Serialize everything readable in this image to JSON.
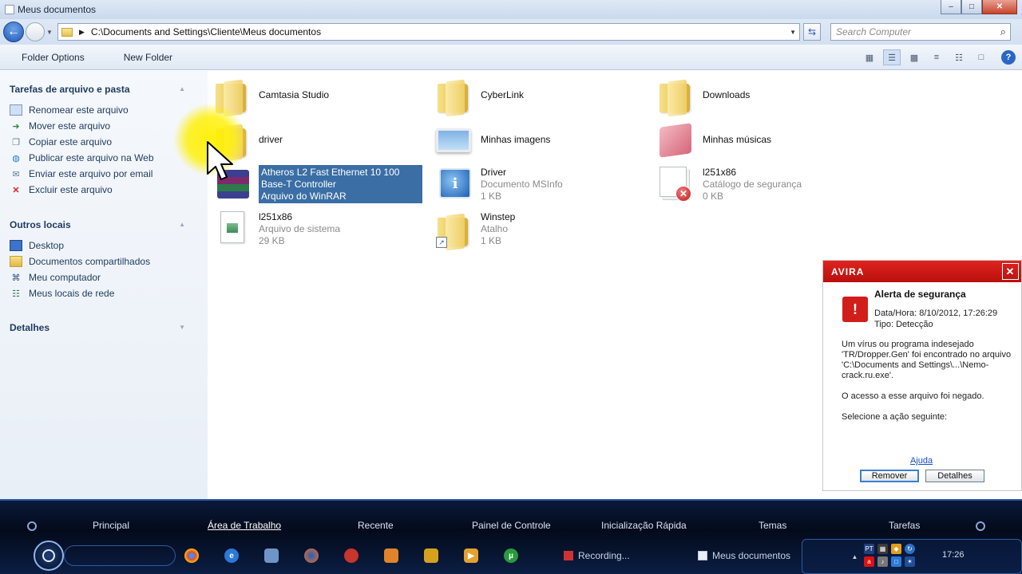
{
  "window": {
    "title": "Meus documentos"
  },
  "address": {
    "path": "C:\\Documents and Settings\\Cliente\\Meus documentos",
    "search_placeholder": "Search Computer"
  },
  "toolbar": {
    "folder_options": "Folder Options",
    "new_folder": "New Folder"
  },
  "sidebar": {
    "tasks_title": "Tarefas de arquivo e pasta",
    "tasks": [
      {
        "label": "Renomear este arquivo",
        "icon": "rename-icon"
      },
      {
        "label": "Mover este arquivo",
        "icon": "move-icon"
      },
      {
        "label": "Copiar este arquivo",
        "icon": "copy-icon"
      },
      {
        "label": "Publicar este arquivo na Web",
        "icon": "web-publish-icon"
      },
      {
        "label": "Enviar este arquivo por email",
        "icon": "email-icon"
      },
      {
        "label": "Excluir este arquivo",
        "icon": "delete-icon"
      }
    ],
    "places_title": "Outros locais",
    "places": [
      {
        "label": "Desktop",
        "icon": "desktop-icon"
      },
      {
        "label": "Documentos compartilhados",
        "icon": "folder-icon"
      },
      {
        "label": "Meu computador",
        "icon": "computer-icon"
      },
      {
        "label": "Meus locais de rede",
        "icon": "network-icon"
      }
    ],
    "details_title": "Detalhes"
  },
  "files": [
    {
      "name": "Camtasia Studio",
      "type": "",
      "size": "",
      "icon": "folder-icon"
    },
    {
      "name": "CyberLink",
      "type": "",
      "size": "",
      "icon": "folder-icon"
    },
    {
      "name": "Downloads",
      "type": "",
      "size": "",
      "icon": "folder-icon"
    },
    {
      "name": "driver",
      "type": "",
      "size": "",
      "icon": "folder-icon"
    },
    {
      "name": "Minhas imagens",
      "type": "",
      "size": "",
      "icon": "pictures-folder-icon"
    },
    {
      "name": "Minhas músicas",
      "type": "",
      "size": "",
      "icon": "music-folder-icon"
    },
    {
      "name": "Atheros L2 Fast Ethernet 10 100 Base-T Controller",
      "type": "Arquivo do WinRAR",
      "size": "",
      "icon": "winrar-icon",
      "selected": true
    },
    {
      "name": "Driver",
      "type": "Documento MSInfo",
      "size": "1 KB",
      "icon": "msinfo-icon"
    },
    {
      "name": "l251x86",
      "type": "Catálogo de segurança",
      "size": "0 KB",
      "icon": "security-catalog-icon"
    },
    {
      "name": "l251x86",
      "type": "Arquivo de sistema",
      "size": "29 KB",
      "icon": "system-file-icon"
    },
    {
      "name": "Winstep",
      "type": "Atalho",
      "size": "1 KB",
      "icon": "shortcut-folder-icon"
    }
  ],
  "avira": {
    "brand": "AVIRA",
    "title": "Alerta de segurança",
    "datetime": "Data/Hora: 8/10/2012, 17:26:29",
    "type": "Tipo: Detecção",
    "message": "Um vírus ou programa indesejado 'TR/Dropper.Gen' foi encontrado no arquivo 'C:\\Documents and Settings\\...\\Nemo-crack.ru.exe'.",
    "denied": "O acesso a esse arquivo foi negado.",
    "select_action": "Selecione a ação seguinte:",
    "help": "Ajuda",
    "remove": "Remover",
    "details": "Detalhes"
  },
  "taskbar": {
    "menus": [
      "Principal",
      "Área de Trabalho",
      "Recente",
      "Painel de Controle",
      "Inicialização Rápida",
      "Temas",
      "Tarefas"
    ],
    "active_menu": "Área de Trabalho",
    "tasks": [
      "Recording...",
      "Meus documentos"
    ],
    "clock": "17:26"
  }
}
